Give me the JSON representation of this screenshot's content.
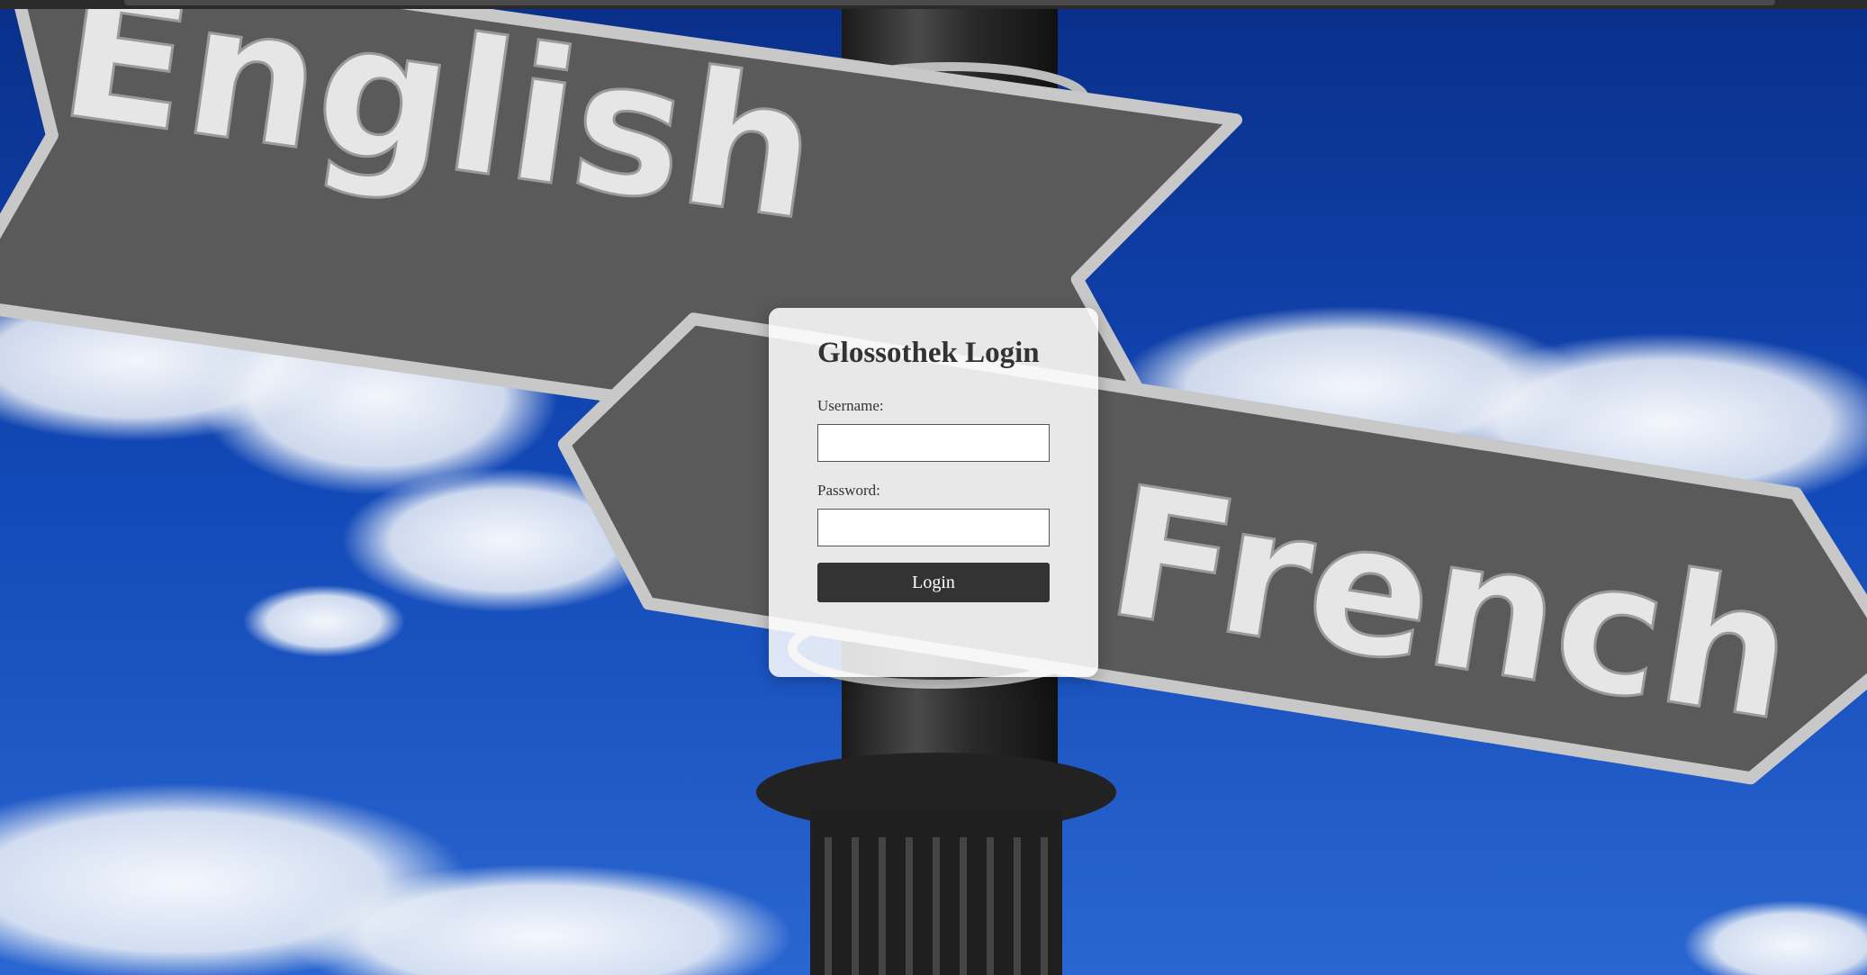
{
  "login": {
    "title": "Glossothek Login",
    "username_label": "Username:",
    "username_value": "",
    "password_label": "Password:",
    "password_value": "",
    "submit_label": "Login"
  },
  "background": {
    "sign_upper_text": "English",
    "sign_lower_text": "French",
    "sky_color": "#0a3a9e",
    "sign_color": "#5a5a5a",
    "sign_text_color": "#e6e6e6",
    "pole_color": "#2b2b2b"
  }
}
